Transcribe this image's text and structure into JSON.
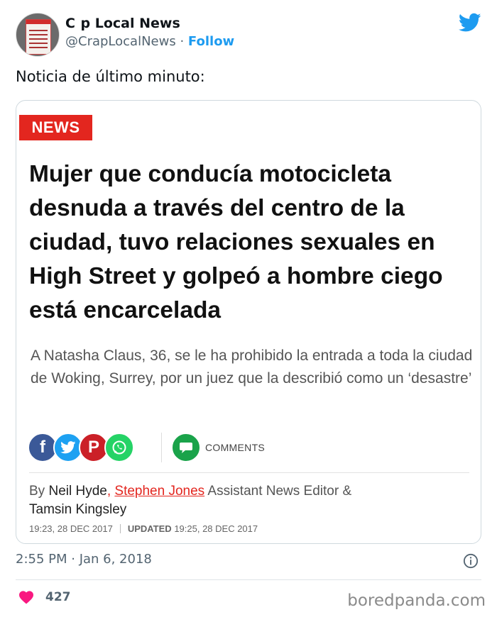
{
  "tweet": {
    "display_name": "C  p Local News",
    "handle": "@CrapLocalNews",
    "separator": "·",
    "follow_label": "Follow",
    "text": "Noticia de último minuto:",
    "timestamp": "2:55 PM · Jan 6, 2018",
    "likes": "427",
    "accent_color": "#1d9bf0",
    "like_color": "#f91880",
    "icons": [
      "twitter-bird-icon",
      "info-icon",
      "heart-icon"
    ]
  },
  "card": {
    "badge": "NEWS",
    "badge_color": "#e3261f",
    "headline": "Mujer que conducía motocicleta desnuda a través del centro de la ciudad, tuvo relaciones sexuales en High Street y golpeó a hombre ciego está encarcelada",
    "summary": "A Natasha Claus, 36, se le ha prohibido la entrada a toda la ciudad de Woking, Surrey, por un juez que la describió como un ‘desastre’",
    "share_icons": [
      "facebook-icon",
      "twitter-icon",
      "pinterest-icon",
      "whatsapp-icon",
      "comments-icon"
    ],
    "comments_label": "COMMENTS",
    "byline": {
      "prefix": "By",
      "author1": "Neil Hyde",
      "comma": ",",
      "author2": "Stephen Jones",
      "role": "Assistant News Editor &",
      "author3": "Tamsin Kingsley"
    },
    "published": "19:23, 28 DEC 2017",
    "updated_label": "UPDATED",
    "updated": "19:25, 28 DEC 2017"
  },
  "watermark": "boredpanda.com"
}
